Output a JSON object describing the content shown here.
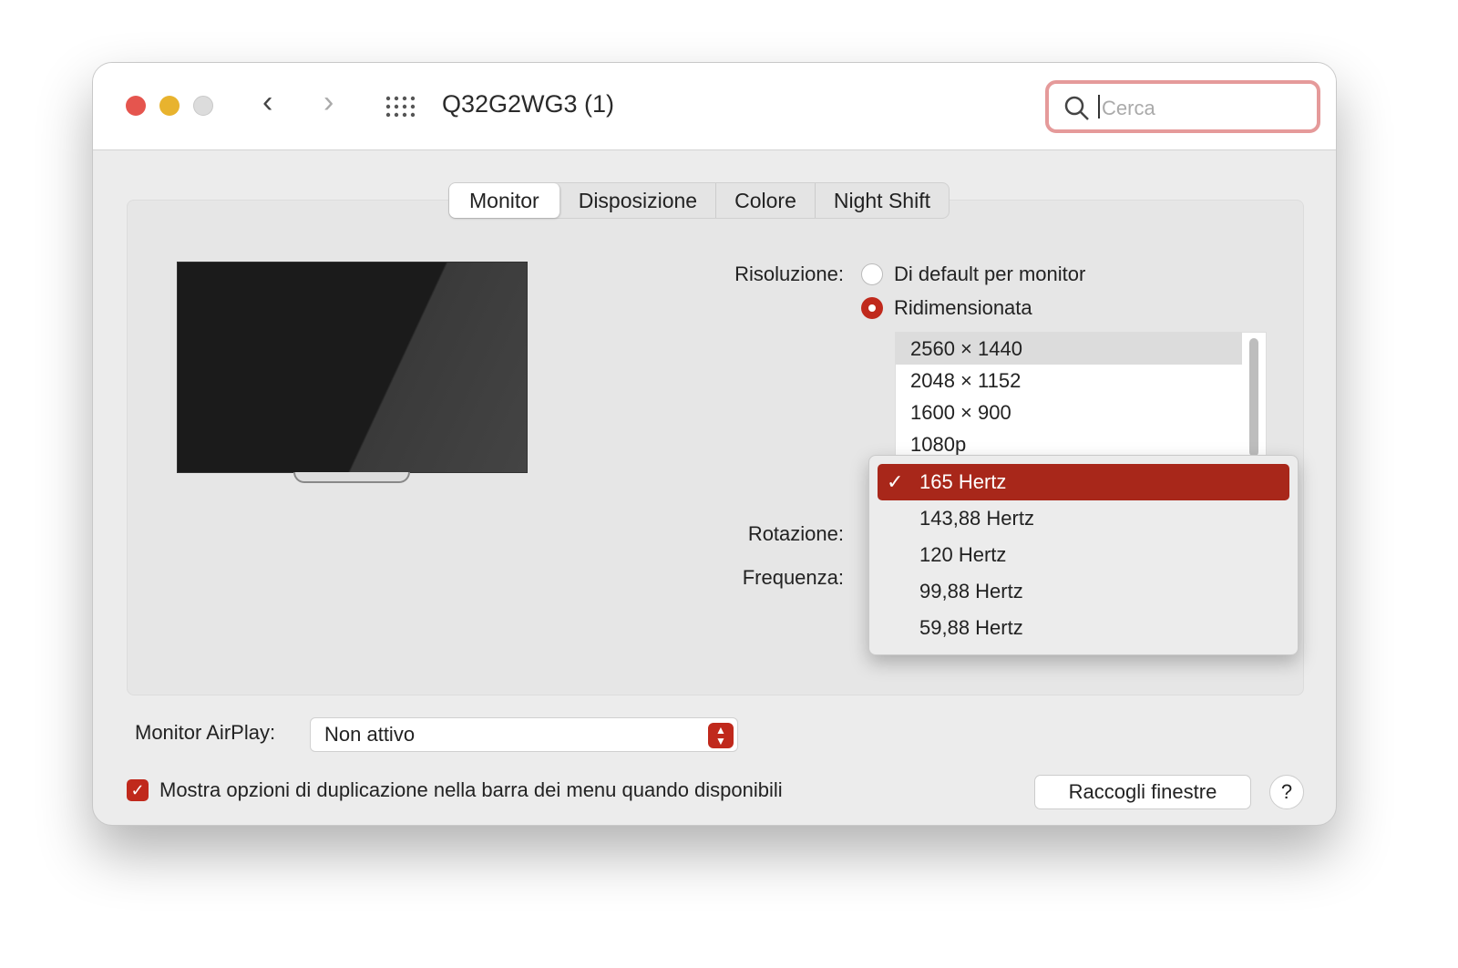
{
  "window": {
    "title": "Q32G2WG3 (1)",
    "search_placeholder": "Cerca"
  },
  "tabs": [
    "Monitor",
    "Disposizione",
    "Colore",
    "Night Shift"
  ],
  "resolution": {
    "label": "Risoluzione:",
    "options": [
      "Di default per monitor",
      "Ridimensionata"
    ],
    "selected_option": "Ridimensionata",
    "list": [
      "2560 × 1440",
      "2048 × 1152",
      "1600 × 900",
      "1080p"
    ],
    "selected": "2560 × 1440"
  },
  "rotation_label": "Rotazione:",
  "frequency": {
    "label": "Frequenza:",
    "menu": [
      "165 Hertz",
      "143,88 Hertz",
      "120 Hertz",
      "99,88 Hertz",
      "59,88 Hertz"
    ],
    "selected": "165 Hertz",
    "check": "✓"
  },
  "airplay": {
    "label": "Monitor AirPlay:",
    "value": "Non attivo"
  },
  "mirror_checkbox": {
    "label": "Mostra opzioni di duplicazione nella barra dei menu quando disponibili",
    "checked": true
  },
  "gather_button": "Raccogli finestre",
  "help_button": "?",
  "colors": {
    "accent": "#c0291c",
    "menu_highlight": "#a8271a"
  }
}
